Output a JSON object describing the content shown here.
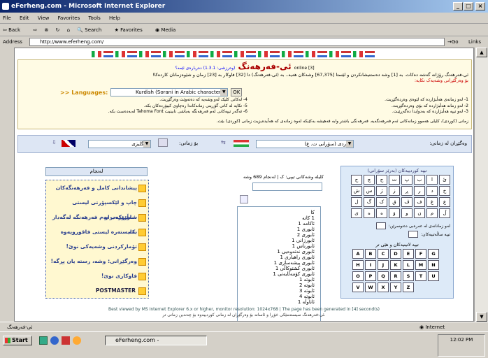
{
  "window": {
    "title": "eFerheng.com - Microsoft Internet Explorer",
    "status_left": "ئی-فەرهەنگ",
    "status_zone": "Internet"
  },
  "menu": [
    "File",
    "Edit",
    "View",
    "Favorites",
    "Tools",
    "Help"
  ],
  "toolbar": [
    "Back",
    "Search",
    "Favorites",
    "Media"
  ],
  "address": {
    "label": "Address",
    "url": "http://www.eferheng.com/",
    "go": "Go",
    "links": "Links"
  },
  "header": {
    "title": "ئی-فەرهەنگ",
    "online": "[3] online",
    "version": "(وەرزشی: 1.3.1) دەربارەی ئێمە؟",
    "intro": "ئی-فەرهەنگ رۆژانە گەشە دەکات. بە [1] وشە دەستنیشانکردن و لێستا [67,375] وشەکان هەیە.. بە (ئی-فەرهەنگ) دا [32] فاوکار بە [23] زمان و شێوەزمانان کاردەکا!",
    "languages_label": ">> Languages:",
    "languages_value": "Kurdish (Sorani in Arabic characters)",
    "ok": "OK",
    "link_red": "بۆ وەرگێڕانی وشەیەک تکایە:",
    "tips": [
      "1- لەو زمانەی هەڵبژاردە کە لێوەی وەردەگێڕیت.",
      "2- لەو زمانە هەڵبژاردە کە بۆی وەردەگێڕیت.",
      "3- لەو تیپە هەڵبژاردە کە بەدوایدا دەگەڕێیت.",
      "4- لەکاتی کلیک لەو وشەیە کە دەتەوێت وەرگێڕیت.",
      "5- تکایە لە کاتی گۆڕینی زمانەکاندا رەچاوی کیبۆردەکان بکە.",
      "6- ئەگەر تیپەکانی لەم فەرهەنگە بەباشی نابینیت Tahoma Font لەبەدەست بکە."
    ],
    "bottom_note": "زمانی (کوردی)، کلیلی هەموو زمانەکانی ئەم فەرهەنگەیە. فەرهەنگی باشتر وابە فەهیشە بەکێبکە لەوە زمانەی کە هەڵبدەیزیت زمانی (کوردی) بێت."
  },
  "translate": {
    "from_label": "وەگێڕان لە زمانی:",
    "from_value": "کوردی (سۆرانی ت. ع)",
    "to_label": "بۆ زمانی:",
    "to_value": "ئینگلیزی"
  },
  "search": {
    "count_text": "کلیلە وشەکانی تیپی: ک | لەنجام 689 وشە",
    "button": "لەنجام"
  },
  "words": [
    "کا",
    "1 کاتە",
    "ئاکامە 1",
    "ئابوری 1",
    "ئابوری 2",
    "ئابورزانی 1",
    "ئابورناس 1",
    "ئابوری نەتەوەیی 1",
    "ئابوری راهباری 1",
    "ئابوری پیشەسازی 1",
    "ئابوری کشتوکاڵی 1",
    "ئابوری کۆمەڵایەتی 1",
    "ئابوتە 1",
    "ئابوتە 2",
    "ئابوتە 3",
    "ئابوتە 4",
    "ئاتاوڵە 1"
  ],
  "links": [
    "پیشاندانی کامل و فەرهەنگەکان",
    "چاپ و لێکسپۆرتی لیستی شەڵێوژەدراو",
    "شاورێکەب بەم فەرهەنگە لەگەدار بکە",
    "بەلیستەرە لیستی فاقوروپەوە",
    "تۆمارکردنی وشەیەکی نوێ!",
    "وەرگێڕانی: وشە، رستە یان پڕگە!",
    "فاوکاری نوێ!",
    "POSTMASTER"
  ],
  "keyboard": {
    "title": "تیپە کوردییەکان (بەرێز سۆرانی)",
    "kurdish_keys": [
      "ئ",
      "ا",
      "ب",
      "پ",
      "ت",
      "ج",
      "چ",
      "ح",
      "خ",
      "د",
      "ر",
      "ڕ",
      "ز",
      "ژ",
      "س",
      "ش",
      "ع",
      "غ",
      "ف",
      "ڤ",
      "ق",
      "ک",
      "گ",
      "ل",
      "ڵ",
      "م",
      "ن",
      "و",
      "ۆ",
      "ه",
      "ە",
      "ی"
    ],
    "option1": "لەو زمانانەی لە عەرەبی دەنوسرێن:",
    "option2": "تیپە ساڵەتییەکان:",
    "latin_title": "تیپە لاتینیەکان و هێی تر",
    "latin_keys": [
      "A",
      "B",
      "C",
      "D",
      "E",
      "F",
      "G",
      "H",
      "I",
      "J",
      "K",
      "L",
      "M",
      "N",
      "O",
      "P",
      "Q",
      "R",
      "S",
      "T",
      "U",
      "V",
      "W",
      "X",
      "Y",
      "Z"
    ]
  },
  "footer": {
    "line1": "Best viewed by MS Internet Explorer 6.x or higher, monitor resolution: 1024x768 | The page has been generated in [4] second(s)",
    "line2": "ئی-فەرهەنگ سیستەمێکی خۆڕا و ئاسانە بۆ وەرگێڕان لە زمانی کوردییەوە بۆ چەندین زمانی تر."
  },
  "taskbar": {
    "start": "Start",
    "task": "eFerheng.com -",
    "clock": "12:02 PM"
  }
}
